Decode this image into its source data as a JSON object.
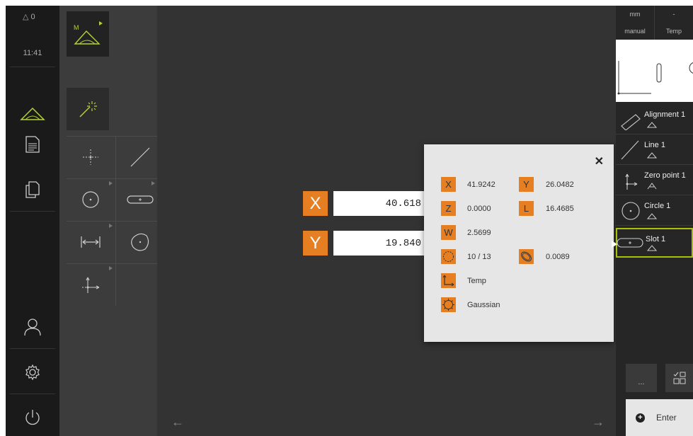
{
  "status": {
    "warning_count": "0",
    "time": "11:41"
  },
  "axes": [
    {
      "label": "X",
      "value": "40.618"
    },
    {
      "label": "Y",
      "value": "19.840"
    }
  ],
  "popup": {
    "close": "✕",
    "x_label": "X",
    "x_value": "41.9242",
    "y_label": "Y",
    "y_value": "26.0482",
    "z_label": "Z",
    "z_value": "0.0000",
    "l_label": "L",
    "l_value": "16.4685",
    "w_label": "W",
    "w_value": "2.5699",
    "points_value": "10 / 13",
    "form_value": "0.0089",
    "reference_value": "Temp",
    "filter_value": "Gaussian"
  },
  "inspector": {
    "unit": "mm",
    "dash": "-",
    "mode": "manual",
    "reference": "Temp",
    "features": [
      {
        "label": "Alignment 1"
      },
      {
        "label": "Line 1"
      },
      {
        "label": "Zero point 1"
      },
      {
        "label": "Circle 1"
      },
      {
        "label": "Slot 1"
      }
    ],
    "more_label": "...",
    "enter_label": "Enter"
  },
  "colors": {
    "accent": "#e67e22",
    "selection": "#aac10a",
    "icon_green": "#b5d334"
  }
}
